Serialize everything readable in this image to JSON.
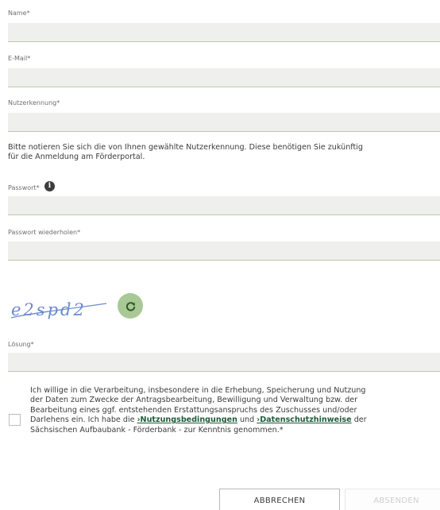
{
  "form": {
    "name": {
      "label": "Name*",
      "value": ""
    },
    "email": {
      "label": "E-Mail*",
      "value": ""
    },
    "username": {
      "label": "Nutzerkennung*",
      "value": ""
    },
    "hint": {
      "line1": "Bitte notieren Sie sich die von Ihnen gewählte Nutzerkennung. Diese benötigen Sie zukünftig",
      "line2": "für die Anmeldung am Förderportal."
    },
    "password": {
      "label": "Passwort*",
      "value": "",
      "info_icon": "info-icon",
      "info_glyph": "i"
    },
    "password_repeat": {
      "label": "Passwort wiederholen*",
      "value": ""
    },
    "captcha": {
      "text": "e2spd2",
      "refresh_icon": "refresh-icon",
      "refresh_color": "#a8c995"
    },
    "solution": {
      "label": "Lösung*",
      "value": ""
    },
    "consent": {
      "checked": false,
      "line1": "Ich willige in die Verarbeitung, insbesondere in die Erhebung, Speicherung und Nutzung",
      "line2": "der Daten zum Zwecke der Antragsbearbeitung, Bewilligung und Verwaltung bzw. der",
      "line3": "Bearbeitung eines ggf. entstehenden Erstattungsanspruchs des Zuschusses und/oder",
      "line4_prefix": "Darlehens ein. Ich habe die ",
      "link_terms": "›Nutzungsbedingungen",
      "line4_middle": " und ",
      "link_privacy": "›Datenschutzhinweise",
      "line4_suffix": " der",
      "line5": "Sächsischen Aufbaubank - Förderbank - zur Kenntnis genommen.*",
      "link_color": "#1f5b3a"
    },
    "buttons": {
      "cancel": "ABBRECHEN",
      "submit": "ABSENDEN"
    }
  }
}
